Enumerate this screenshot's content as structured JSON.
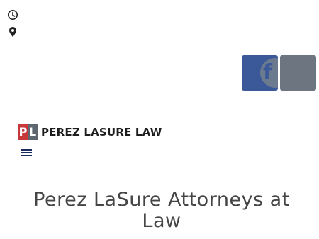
{
  "top_info": {
    "icons": [
      "clock-icon",
      "map-pin-icon"
    ]
  },
  "social": {
    "facebook_glyph": "f",
    "facebook_color": "#3b5998",
    "other_color": "#6d7680"
  },
  "logo": {
    "mark_p": "P",
    "mark_l": "L",
    "text": "PEREZ LASURE LAW",
    "mark_red": "#c8373a",
    "mark_gray": "#5e6670"
  },
  "nav": {
    "menu_icon": "hamburger-menu-icon",
    "menu_color": "#1a2a5c"
  },
  "page": {
    "title": "Perez LaSure Attorneys at Law"
  }
}
